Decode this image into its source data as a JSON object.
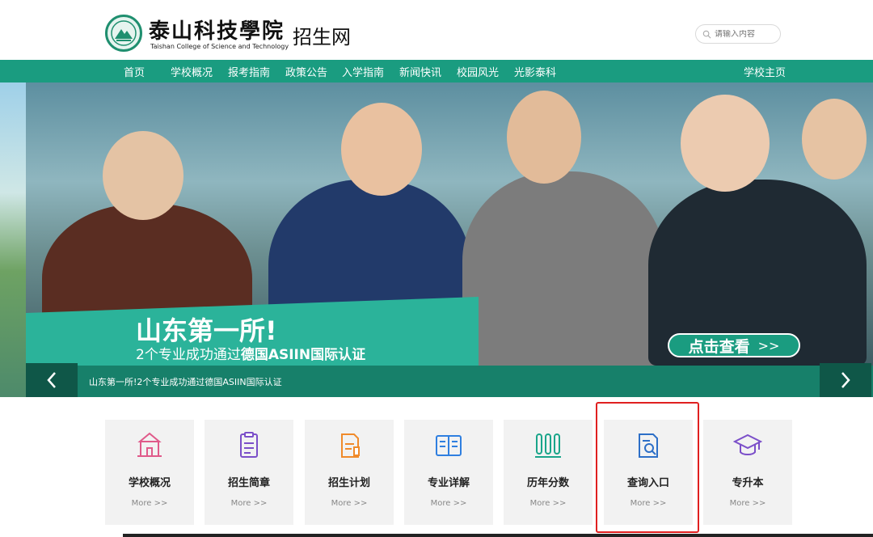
{
  "header": {
    "college_name_cn": "泰山科技學院",
    "college_name_en": "Taishan College of Science and Technology",
    "site_name": "招生网",
    "search_placeholder": "请输入内容"
  },
  "nav": {
    "items": [
      "首页",
      "学校概况",
      "报考指南",
      "政策公告",
      "入学指南",
      "新闻快讯",
      "校园风光",
      "光影泰科"
    ],
    "right_item": "学校主页"
  },
  "banner": {
    "slogan_line1": "山东第一所!",
    "slogan_line2_prefix": "2个专业成功通过",
    "slogan_line2_bold": "德国ASIIN国际认证",
    "view_button_label": "点击查看",
    "view_button_arrows": ">>",
    "caption": "山东第一所!2个专业成功通过德国ASIIN国际认证"
  },
  "tiles": [
    {
      "label": "学校概况",
      "more": "More >>",
      "icon": "school-building-icon",
      "color": "#e05a8a"
    },
    {
      "label": "招生简章",
      "more": "More >>",
      "icon": "document-icon",
      "color": "#7b4fc9"
    },
    {
      "label": "招生计划",
      "more": "More >>",
      "icon": "plan-document-icon",
      "color": "#f08a2a"
    },
    {
      "label": "专业详解",
      "more": "More >>",
      "icon": "open-book-icon",
      "color": "#2f7fe0"
    },
    {
      "label": "历年分数",
      "more": "More >>",
      "icon": "bar-columns-icon",
      "color": "#1aa58a"
    },
    {
      "label": "查询入口",
      "more": "More >>",
      "icon": "search-document-icon",
      "color": "#2d6fc7"
    },
    {
      "label": "专升本",
      "more": "More >>",
      "icon": "graduation-cap-icon",
      "color": "#7b4fc9"
    }
  ],
  "colors": {
    "brand_green": "#1a9c80",
    "highlight_red": "#e02020"
  }
}
